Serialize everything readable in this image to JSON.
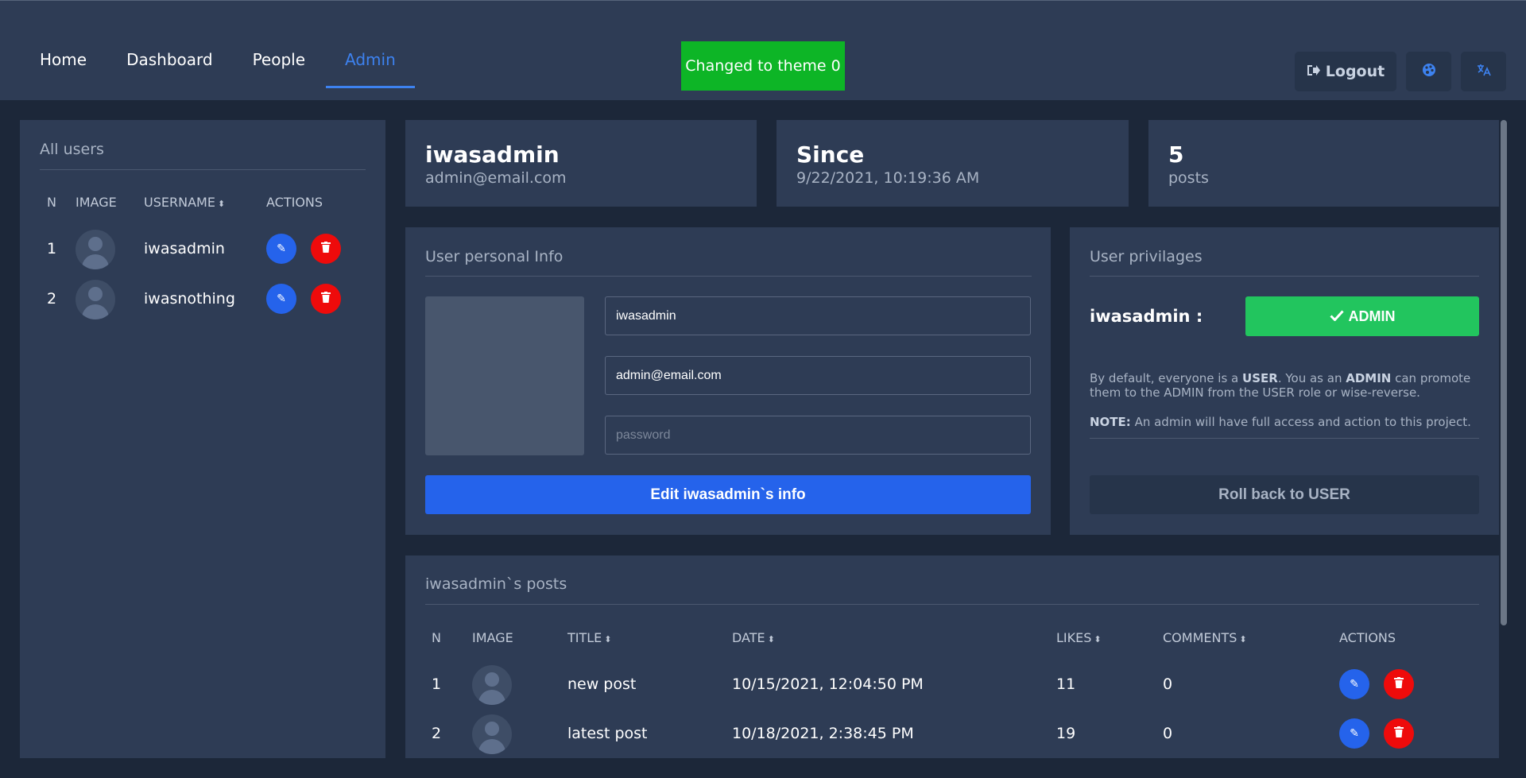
{
  "nav": {
    "items": [
      {
        "label": "Home",
        "active": false
      },
      {
        "label": "Dashboard",
        "active": false
      },
      {
        "label": "People",
        "active": false
      },
      {
        "label": "Admin",
        "active": true
      }
    ]
  },
  "toast": {
    "text": "Changed to theme 0",
    "color": "#0db526"
  },
  "topbar": {
    "logout_label": "Logout",
    "logout_icon": "logout-icon",
    "theme_icon": "palette-icon",
    "language_icon": "translate-icon"
  },
  "users": {
    "title": "All users",
    "headers": {
      "n": "N",
      "image": "IMAGE",
      "username": "USERNAME",
      "actions": "ACTIONS"
    },
    "rows": [
      {
        "n": "1",
        "username": "iwasadmin"
      },
      {
        "n": "2",
        "username": "iwasnothing"
      }
    ]
  },
  "stats": {
    "user": {
      "big": "iwasadmin",
      "small": "admin@email.com"
    },
    "since": {
      "big": "Since",
      "small": "9/22/2021, 10:19:36 AM"
    },
    "posts": {
      "big": "5",
      "small": "posts"
    }
  },
  "personal_info": {
    "title": "User personal Info",
    "username_value": "iwasadmin",
    "email_value": "admin@email.com",
    "password_placeholder": "password",
    "edit_button": "Edit iwasadmin`s info"
  },
  "privileges": {
    "title": "User privilages",
    "user_label": "iwasadmin :",
    "role_button": "ADMIN",
    "desc_1": "By default, everyone is a ",
    "desc_user": "USER",
    "desc_2": ". You as an ",
    "desc_admin": "ADMIN",
    "desc_3": " can promote them to the ADMIN from the USER role or wise-reverse.",
    "note_label": "NOTE:",
    "note_text": " An admin will have full access and action to this project.",
    "rollback_button": "Roll back to USER"
  },
  "posts": {
    "title": "iwasadmin`s posts",
    "headers": {
      "n": "N",
      "image": "IMAGE",
      "title": "TITLE",
      "date": "DATE",
      "likes": "LIKES",
      "comments": "COMMENTS",
      "actions": "ACTIONS"
    },
    "rows": [
      {
        "n": "1",
        "title": "new post",
        "date": "10/15/2021, 12:04:50 PM",
        "likes": "11",
        "comments": "0"
      },
      {
        "n": "2",
        "title": "latest post",
        "date": "10/18/2021, 2:38:45 PM",
        "likes": "19",
        "comments": "0"
      }
    ]
  },
  "colors": {
    "accent": "#3d82f0",
    "primary_button": "#2563eb",
    "success": "#22c55e",
    "danger": "#ee0b0b",
    "panel": "#2e3c55",
    "background": "#1c2739"
  }
}
